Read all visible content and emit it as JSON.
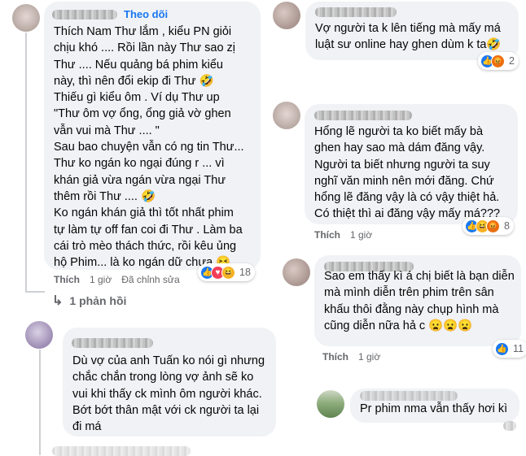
{
  "comments": {
    "c1": {
      "follow": "Theo dõi",
      "text": "Thích Nam Thư lắm , kiểu PN giỏi\nchịu khó .... Rồi lần này Thư sao zị\nThư .... Nếu quảng bá phim kiểu\nnày, thì nên đổi ekip đi Thư 🤣\nThiếu gì kiểu ôm . Ví dụ Thư up\n\"Thư ôm vợ ổng, ổng giả vờ ghen\nvẫn vui mà Thư .... \"\nSau bao chuyện vẫn có ng tin Thư...\nThư ko ngán ko ngại đúng r ... vì\nkhán giả vừa ngán vừa ngại Thư\nthêm rồi Thư .... 🤣\nKo ngán khán giả thì tốt nhất phim\ntự làm tự off fan coi đi Thư . Làm ba\ncái trò mèo thách thức, rồi kêu ủng\nhộ Phim... là ko ngán dữ chưa 😝",
      "like_label": "Thích",
      "time": "1 giờ",
      "edited": "Đã chỉnh sửa",
      "reaction_icons": [
        "like",
        "love",
        "haha"
      ],
      "reaction_count": "18",
      "replies_label": "1 phản hồi"
    },
    "c2": {
      "text": "Dù vợ của anh Tuấn ko nói gì nhưng\nchắc chắn trong lòng vợ ảnh sẽ ko\nvui khi thấy ck mình ôm người khác.\nBớt bớt thân mật với ck người ta lại\nđi má"
    },
    "c3": {
      "text": "Vợ người ta k lên tiếng mà mấy má\nluật sư online hay ghen dùm k ta🤣",
      "reaction_icons": [
        "like",
        "angry"
      ],
      "reaction_count": "2"
    },
    "c4": {
      "text": "Hổng lẽ người ta ko biết mấy bà\nghen hay sao mà dám đăng vậy.\nNgười ta biết nhưng người ta suy\nnghĩ văn minh nên mới đăng. Chứ\nhổng lẽ đăng vậy là có vậy thiệt hả.\nCó thiệt thì ai đăng vậy mấy má???",
      "like_label": "Thích",
      "time": "1 giờ",
      "reaction_icons": [
        "like",
        "haha",
        "angry"
      ],
      "reaction_count": "8"
    },
    "c5": {
      "text": "Sao em thấy kì á chị biết là bạn diễn\nmà mình diễn trên phim trên sân\nkhấu thôi đằng này chụp hình mà\ncũng diễn nữa hả c 😦😦😦",
      "like_label": "Thích",
      "time": "1 giờ",
      "reaction_icons": [
        "like"
      ],
      "reaction_count": "11"
    },
    "c6": {
      "text": "Pr phim nma vẫn thấy hơi kì"
    }
  },
  "icons": {
    "like": "👍",
    "love": "♥",
    "haha": "😆",
    "angry": "😡",
    "reply_arrow": "↳"
  }
}
